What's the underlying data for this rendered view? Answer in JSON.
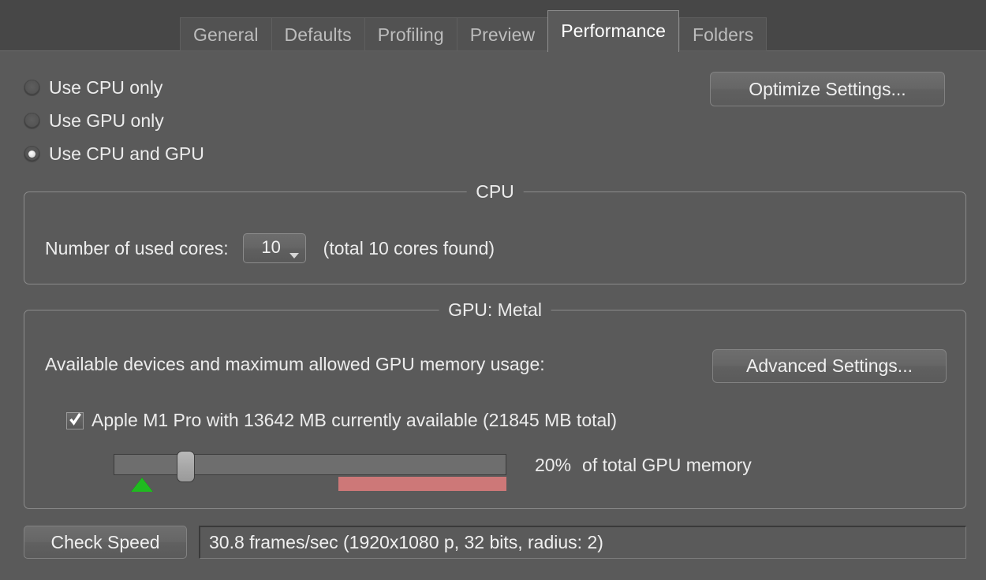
{
  "window": {
    "tabs": [
      {
        "label": "General",
        "active": false
      },
      {
        "label": "Defaults",
        "active": false
      },
      {
        "label": "Profiling",
        "active": false
      },
      {
        "label": "Preview",
        "active": false
      },
      {
        "label": "Performance",
        "active": true
      },
      {
        "label": "Folders",
        "active": false
      }
    ]
  },
  "processing_mode": {
    "options": [
      {
        "label": "Use CPU only",
        "selected": false
      },
      {
        "label": "Use GPU only",
        "selected": false
      },
      {
        "label": "Use CPU and GPU",
        "selected": true
      }
    ]
  },
  "buttons": {
    "optimize_settings": "Optimize Settings...",
    "advanced_settings": "Advanced Settings...",
    "check_speed": "Check Speed"
  },
  "cpu": {
    "legend": "CPU",
    "cores_label": "Number of used cores:",
    "cores_value": "10",
    "cores_total_text": "(total 10 cores found)"
  },
  "gpu": {
    "legend": "GPU: Metal",
    "description": "Available devices and maximum allowed GPU memory usage:",
    "device": {
      "enabled": true,
      "label": "Apple M1 Pro with 13642 MB currently available (21845 MB total)"
    },
    "memory_slider": {
      "percent_label": "20%",
      "caption": "of total GPU memory",
      "value_percent": 20
    }
  },
  "status": {
    "speed_result": "30.8 frames/sec (1920x1080 p, 32 bits, radius: 2)"
  },
  "colors": {
    "window_background": "#5a5a5a",
    "tabbar_background": "#474747",
    "accent_marker_green": "#1fbb1f",
    "warning_bar_red": "#cd7878",
    "text_primary": "#ececec",
    "text_inactive_tab": "#bdbdbd"
  }
}
